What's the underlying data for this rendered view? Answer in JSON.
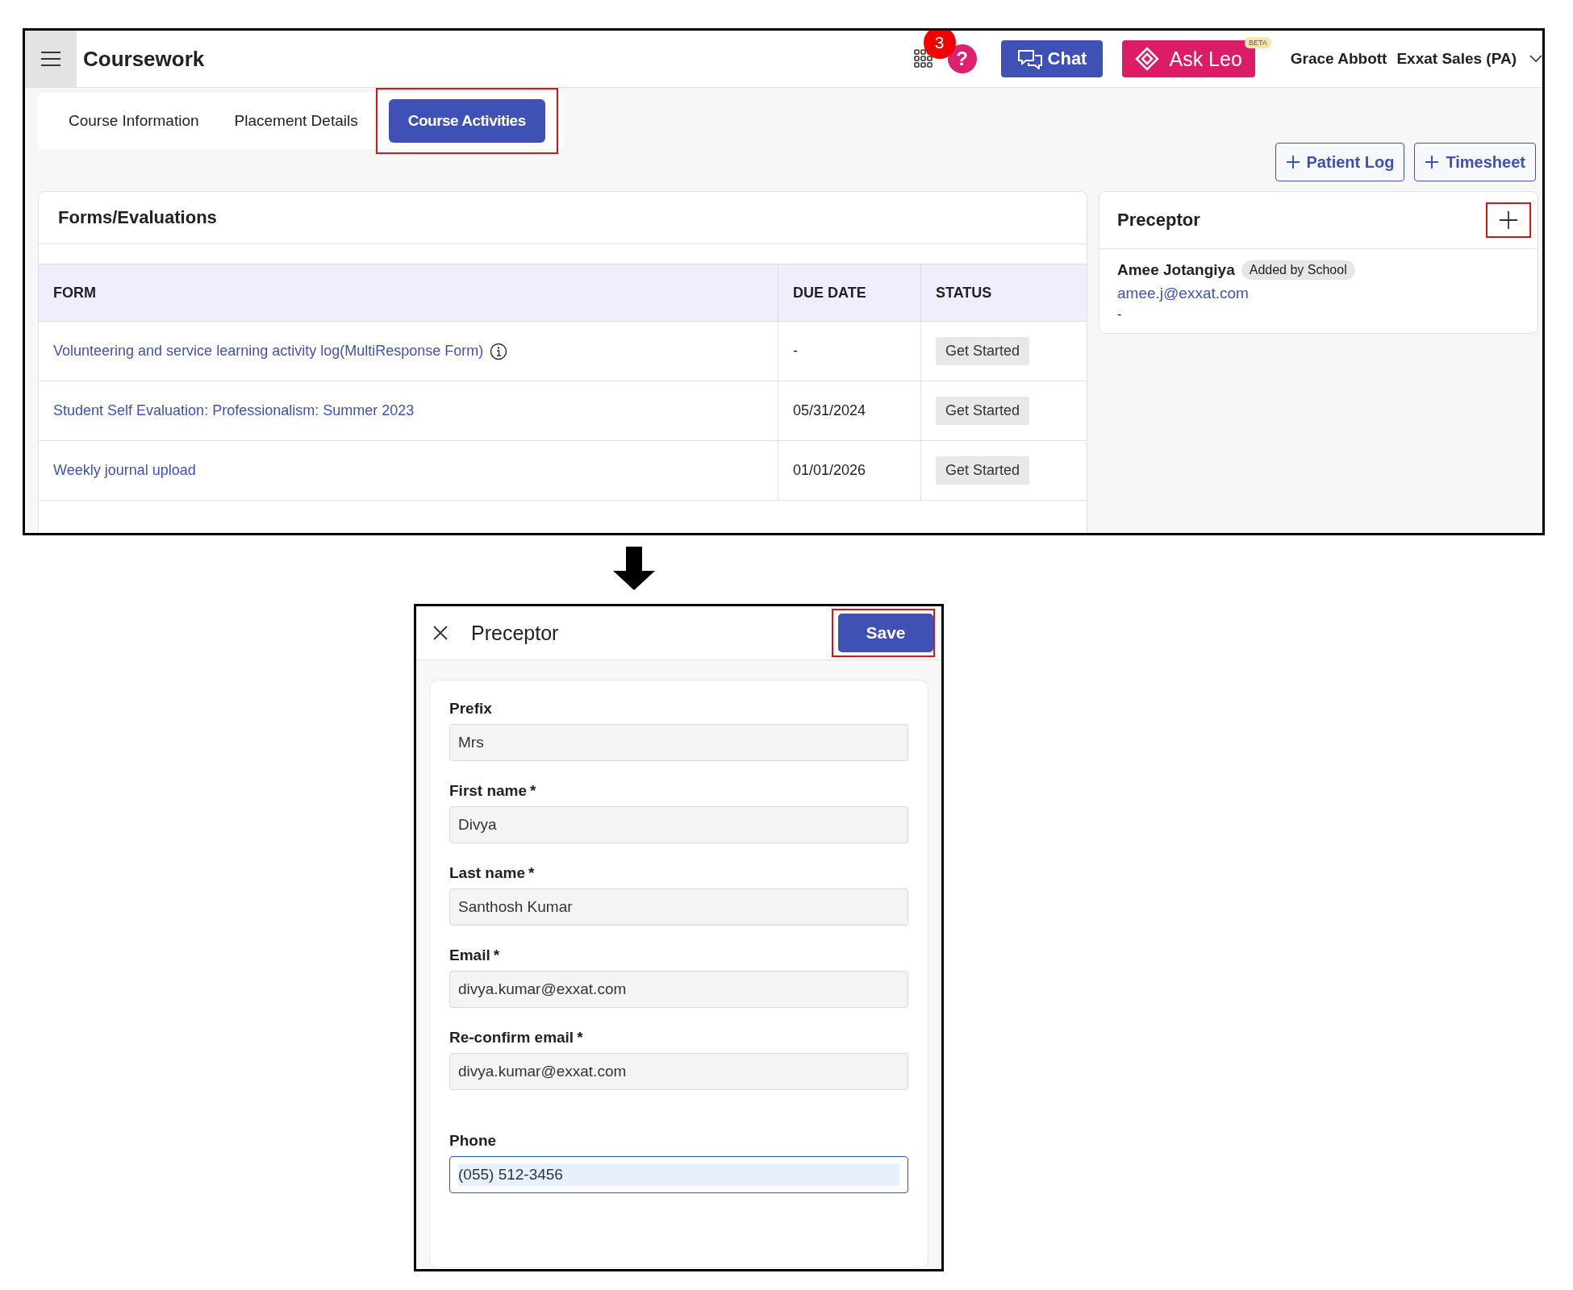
{
  "app": {
    "title": "Coursework",
    "notification_count": "3",
    "help_icon": "?",
    "chat_button": "Chat",
    "ask_button": "Ask Leo",
    "ask_badge": "BETA",
    "user_name": "Grace Abbott",
    "organization": "Exxat Sales (PA)"
  },
  "tabs": [
    {
      "label": "Course Information",
      "selected": false,
      "highlighted": false
    },
    {
      "label": "Placement Details",
      "selected": false,
      "highlighted": false
    },
    {
      "label": "Course Activities",
      "selected": true,
      "highlighted": true
    }
  ],
  "actions": [
    "Patient Log",
    "Timesheet"
  ],
  "forms": {
    "title": "Forms/Evaluations",
    "columns": [
      "FORM",
      "DUE DATE",
      "STATUS"
    ],
    "rows": [
      {
        "form": "Volunteering and service learning activity log(MultiResponse Form)",
        "info": true,
        "due": "-",
        "status": "Get Started"
      },
      {
        "form": "Student Self Evaluation: Professionalism: Summer 2023",
        "info": false,
        "due": "05/31/2024",
        "status": "Get Started"
      },
      {
        "form": "Weekly journal upload",
        "info": false,
        "due": "01/01/2026",
        "status": "Get Started"
      }
    ]
  },
  "preceptor_panel": {
    "title": "Preceptor",
    "add_highlighted": true,
    "name": "Amee Jotangiya",
    "tag": "Added by School",
    "email": "amee.j@exxat.com",
    "phone": "-"
  },
  "dialog": {
    "title": "Preceptor",
    "save": "Save",
    "save_highlighted": true,
    "fields": [
      {
        "label": "Prefix",
        "value": "Mrs",
        "focused": false
      },
      {
        "label": "First name",
        "required_mark": "*",
        "value": "Divya",
        "focused": false
      },
      {
        "label": "Last name",
        "required_mark": "*",
        "value": "Santhosh Kumar",
        "focused": false
      },
      {
        "label": "Email",
        "required_mark": "*",
        "value": "divya.kumar@exxat.com",
        "focused": false
      },
      {
        "label": "Re-confirm email",
        "required_mark": "*",
        "value": "divya.kumar@exxat.com",
        "focused": false
      },
      {
        "label": "Phone",
        "value": "(055) 512-3456",
        "focused": true
      }
    ]
  }
}
